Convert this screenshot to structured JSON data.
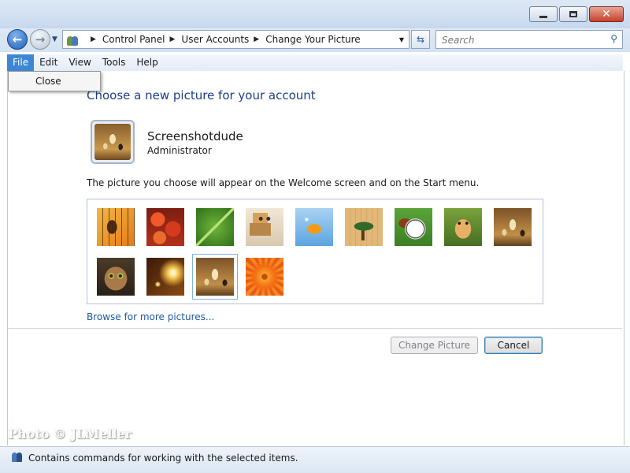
{
  "window": {
    "minimize_glyph": "",
    "close_glyph": "✕"
  },
  "nav": {
    "back_glyph": "←",
    "forward_glyph": "→",
    "recent_glyph": "▼",
    "refresh_glyph": "⇆"
  },
  "address": {
    "crumbs": [
      "Control Panel",
      "User Accounts",
      "Change Your Picture"
    ],
    "separator": "▶",
    "dropdown_glyph": "▼"
  },
  "search": {
    "placeholder": "Search",
    "icon_glyph": "⚲"
  },
  "menu": {
    "items": [
      "File",
      "Edit",
      "View",
      "Tools",
      "Help"
    ],
    "open_menu": "File",
    "file_dropdown": [
      "Close"
    ]
  },
  "main": {
    "heading": "Choose a new picture for your account",
    "user_name": "Screenshotdude",
    "user_role": "Administrator",
    "description": "The picture you choose will appear on the Welcome screen and on the Start menu.",
    "pictures": [
      {
        "subject": "guitar",
        "selected": false
      },
      {
        "subject": "starfish",
        "selected": false
      },
      {
        "subject": "leaf",
        "selected": false
      },
      {
        "subject": "robot",
        "selected": false
      },
      {
        "subject": "fish",
        "selected": false
      },
      {
        "subject": "bonsai",
        "selected": false
      },
      {
        "subject": "soccer-ball",
        "selected": false
      },
      {
        "subject": "dog",
        "selected": false
      },
      {
        "subject": "chess",
        "selected": false
      },
      {
        "subject": "kitten",
        "selected": false
      },
      {
        "subject": "sparkles",
        "selected": false
      },
      {
        "subject": "chess",
        "selected": true
      },
      {
        "subject": "flower",
        "selected": false
      }
    ],
    "browse_link": "Browse for more pictures...",
    "change_button": "Change Picture",
    "cancel_button": "Cancel"
  },
  "watermark": "Photo © JLMeller",
  "status": {
    "text": "Contains commands for working with the selected items."
  },
  "colors": {
    "heading": "#1e3f88",
    "link": "#1e5aa5",
    "menu_active": "#3d86d6"
  }
}
